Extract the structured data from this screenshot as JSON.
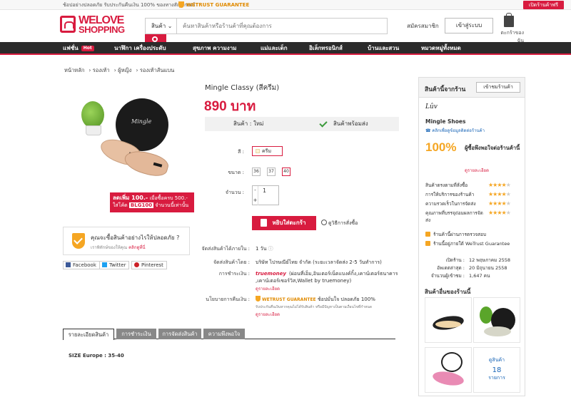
{
  "topbar": {
    "promo": "ช้อปอย่างปลอดภัย รับประกันคืนเงิน 100% ของทางสัญลักษณ์",
    "wetrust": "WETRUST GUARANTEE",
    "open_shop": "เปิดร้านค้าฟรี"
  },
  "header": {
    "logo_line1": "WELOVE",
    "logo_line2": "SHOPPING",
    "search_category": "สินค้า",
    "search_placeholder": "ค้นหาสินค้าหรือร้านค้าที่คุณต้องการ",
    "register": "สมัครสมาชิก",
    "login": "เข้าสู่ระบบ",
    "cart": "ตะกร้าของฉัน"
  },
  "nav": {
    "items": [
      "แฟชั่น",
      "นาฬิกา เครื่องประดับ",
      "สุขภาพ ความงาม",
      "แม่และเด็ก",
      "อิเล็กทรอนิกส์",
      "บ้านและสวน",
      "หมวดหมู่ทั้งหมด"
    ],
    "hot": "Hot"
  },
  "breadcrumb": [
    "หน้าหลัก",
    "รองเท้า",
    "ผู้หญิง",
    "รองเท้าส้นแบน"
  ],
  "product": {
    "title": "Mingle Classy (สีครีม)",
    "price": "890 บาท",
    "condition": "สินค้า : ใหม่",
    "stock": "สินค้าพร้อมส่ง",
    "color_label": "สี :",
    "color_value": "ครีม",
    "size_label": "ขนาด :",
    "sizes": [
      "36",
      "37",
      "40"
    ],
    "qty_label": "จำนวน :",
    "qty": "1",
    "add_to_cart": "หยิบใส่ตะกร้า",
    "how_to_order": "ดูวิธีการสั่งซื้อ",
    "image_brand": "Mingle"
  },
  "promo": {
    "line1": "ลดเพิ่ม 100.-",
    "line1b": "เมื่อซื้อครบ 500.-",
    "line2a": "ใส่โค้ด",
    "code": "BLG100",
    "line2b": "จำนวนนี้เท่านั้น"
  },
  "safe_box": {
    "title": "คุณจะซื้อสินค้าอย่างไรให้ปลอดภัย ?",
    "sub": "เราพิทักษ์ของให้คุณ",
    "link": "คลิกดูที่นี่"
  },
  "share": {
    "facebook": "Facebook",
    "twitter": "Twitter",
    "pinterest": "Pinterest"
  },
  "shipping": {
    "ship_in_label": "จัดส่งสินค้าได้ภายใน :",
    "ship_in": "1 วัน",
    "ship_by_label": "จัดส่งสินค้าโดย :",
    "ship_by": "บริษัท ไปรษณีย์ไทย จำกัด (ระยะเวลาจัดส่ง 2-5 วันทำการ)",
    "payment_label": "การชำระเงิน :",
    "payment_brand": "truemoney",
    "payment_line1": "(ผ่อนที่เอ็ม,อินเตอร์เน็ตแบงค์กิ้ง,เคาน์เตอร์ธนาคาร",
    "payment_line2": ",เคาน์เตอร์เซอร์วิส,Wallet by truemoney)",
    "payment_more": "ดูรายละเอียด",
    "refund_label": "นโยบายการคืนเงิน :",
    "refund_brand": "WETRUST GUARANTEE",
    "refund_text": "ช้อปมั่นใจ ปลอดภัย 100%",
    "refund_sub": "รับประกันคืนเงินหากคุณไม่ได้รับสินค้า หรือมีปัญหาเป็นตามเงื่อนไขที่กำหนด",
    "refund_more": "ดูรายละเอียด"
  },
  "tabs": [
    "รายละเอียดสินค้า",
    "การชำระเงิน",
    "การจัดส่งสินค้า",
    "ความพึงพอใจ"
  ],
  "description": "SIZE Europe : 35-40",
  "shop": {
    "header": "สินค้านี้จากร้าน",
    "enter_shop": "เข้าชมร้านค้า",
    "logo": "Lûv",
    "name": "Mingle Shoes",
    "contact": "คลิกเพื่อดูข้อมูลติดต่อร้านค้า",
    "satisfaction": "100%",
    "satisfaction_text": "ผู้ซื้อพึงพอใจต่อร้านค้านี้",
    "detail_link": "ดูรายละเอียด",
    "ratings": [
      {
        "label": "สินค้าตรงตามที่สั่งซื้อ",
        "stars": 4
      },
      {
        "label": "การให้บริการของร้านค้า",
        "stars": 4
      },
      {
        "label": "ความรวดเร็วในการจัดส่ง",
        "stars": 4
      },
      {
        "label": "คุณภาพที่บรรจุถ่อมผลการจัดส่ง",
        "stars": 4
      }
    ],
    "badges": [
      "ร้านค้านี้ผ่านการตรวจสอบ",
      "ร้านนี้อยู่ภายใต้ WeTrust Guarantee"
    ],
    "stats": [
      {
        "k": "เปิดร้าน :",
        "v": "12 พฤษภาคม 2558"
      },
      {
        "k": "อัพเดตล่าสุด :",
        "v": "20 มิถุนายน 2558"
      },
      {
        "k": "จำนวนผู้เข้าชม :",
        "v": "1,647 คน"
      }
    ],
    "other_title": "สินค้าอื่นของร้านนี้",
    "more_label": "ดูสินค้า",
    "more_count": "18",
    "more_unit": "รายการ"
  }
}
